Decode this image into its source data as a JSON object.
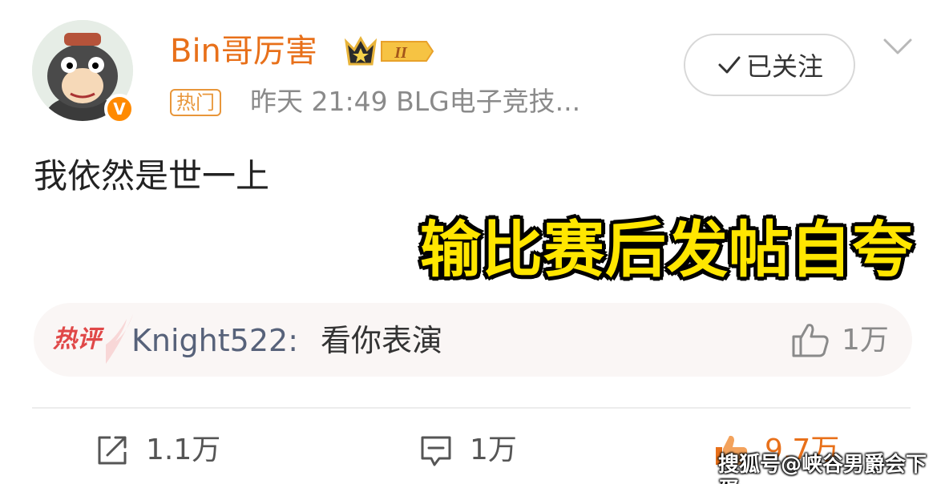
{
  "post": {
    "username": "Bin哥厉害",
    "verified_badge": "V",
    "crown_level": "II",
    "hot_tag": "热门",
    "meta": "昨天 21:49  BLG电子竞技...",
    "follow_label": "已关注",
    "text": "我依然是世一上",
    "overlay_caption": "输比赛后发帖自夸"
  },
  "hot_comment": {
    "label": "热评",
    "user": "Knight522:",
    "text": "看你表演",
    "likes": "1万"
  },
  "actions": {
    "repost_count": "1.1万",
    "comment_count": "1万",
    "like_count": "9.7万"
  },
  "watermark": "搜狐号@峡谷男爵会下蛋",
  "icons": {
    "crown": "crown-icon",
    "follow_check": "check-icon",
    "more": "chevron-down-icon",
    "comment_like": "thumbs-up-icon",
    "repost": "repost-icon",
    "comment": "comment-icon",
    "like": "thumbs-up-filled-icon"
  },
  "colors": {
    "username": "#e8701a",
    "hot_tag": "#e8963a",
    "caption": "#ffe600",
    "comment_user": "#57627a",
    "like_active": "#e8701a"
  }
}
